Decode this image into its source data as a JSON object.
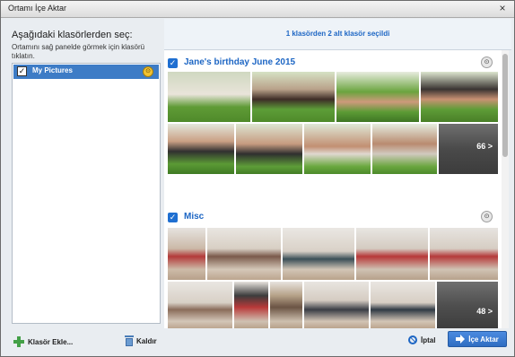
{
  "window": {
    "title": "Ortamı İçe Aktar",
    "close": "×"
  },
  "left": {
    "title": "Aşağıdaki klasörlerden seç:",
    "description": "Ortamını sağ panelde görmek için klasörü tıklatın.",
    "folders": [
      {
        "label": "My Pictures",
        "checked": true
      }
    ],
    "add_label": "Klasör Ekle...",
    "remove_label": "Kaldır"
  },
  "right": {
    "selection_status": "1 klasörden 2 alt klasör seçildi",
    "groups": [
      {
        "name": "Jane's birthday June 2015",
        "more_label": "66 >"
      },
      {
        "name": "Misc",
        "more_label": "48 >"
      }
    ],
    "cancel_label": "İptal",
    "import_label": "İçe Aktar"
  },
  "icons": {
    "close": "close-icon",
    "scan": "binoculars-icon",
    "add": "plus-icon",
    "remove": "trash-icon",
    "cancel": "cancel-icon",
    "import": "import-arrow-icon"
  },
  "colors": {
    "accent": "#1d66c4",
    "selection": "#3d7cc6",
    "button": "#2f6dc2"
  }
}
